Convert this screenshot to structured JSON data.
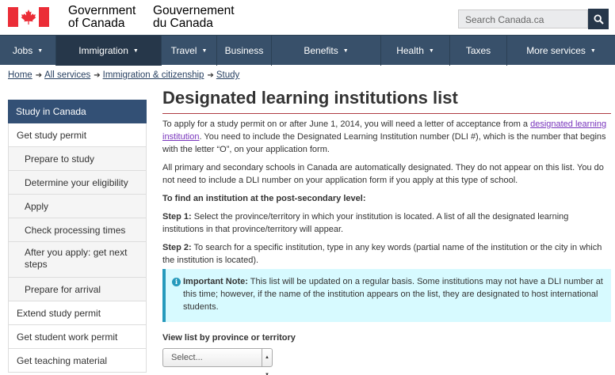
{
  "header": {
    "wordmark_en": [
      "Government",
      "of Canada"
    ],
    "wordmark_fr": [
      "Gouvernement",
      "du Canada"
    ],
    "search_placeholder": "Search Canada.ca",
    "flag_color": "#eb2d37"
  },
  "nav": {
    "items": [
      {
        "label": "Jobs",
        "dropdown": true
      },
      {
        "label": "Immigration",
        "dropdown": true,
        "active": true
      },
      {
        "label": "Travel",
        "dropdown": true
      },
      {
        "label": "Business",
        "dropdown": false
      },
      {
        "label": "Benefits",
        "dropdown": true
      },
      {
        "label": "Health",
        "dropdown": true
      },
      {
        "label": "Taxes",
        "dropdown": false
      },
      {
        "label": "More services",
        "dropdown": true
      }
    ]
  },
  "breadcrumb": [
    "Home",
    "All services",
    "Immigration & citizenship",
    "Study"
  ],
  "sidebar": {
    "heading": "Study in Canada",
    "items": [
      {
        "label": "Get study permit",
        "sub": false
      },
      {
        "label": "Prepare to study",
        "sub": true
      },
      {
        "label": "Determine your eligibility",
        "sub": true
      },
      {
        "label": "Apply",
        "sub": true
      },
      {
        "label": "Check processing times",
        "sub": true
      },
      {
        "label": "After you apply: get next steps",
        "sub": true
      },
      {
        "label": "Prepare for arrival",
        "sub": true
      },
      {
        "label": "Extend study permit",
        "sub": false
      },
      {
        "label": "Get student work permit",
        "sub": false
      },
      {
        "label": "Get teaching material",
        "sub": false
      }
    ]
  },
  "main": {
    "title": "Designated learning institutions list",
    "intro_before_link": "To apply for a study permit on or after June 1, 2014, you will need a letter of acceptance from a ",
    "intro_link": "designated learning institution",
    "intro_after_link": ". You need to include the Designated Learning Institution number (DLI #), which is the number that begins with the letter “O”, on your application form.",
    "para2": "All primary and secondary schools in Canada are automatically designated. They do not appear on this list. You do not need to include a DLI number on your application form if you apply at this type of school.",
    "find_heading": "To find an institution at the post-secondary level:",
    "step1_label": "Step 1:",
    "step1_text": " Select the province/territory in which your institution is located. A list of all the designated learning institutions in that province/territory will appear.",
    "step2_label": "Step 2:",
    "step2_text": " To search for a specific institution, type in any key words (partial name of the institution or the city in which the institution is located).",
    "note_label": "Important Note:",
    "note_text": " This list will be updated on a regular basis. Some institutions may not have a DLI number at this time; however, if the name of the institution appears on the list, they are designated to host international students.",
    "select_label": "View list by province or territory",
    "select_value": "Select..."
  }
}
